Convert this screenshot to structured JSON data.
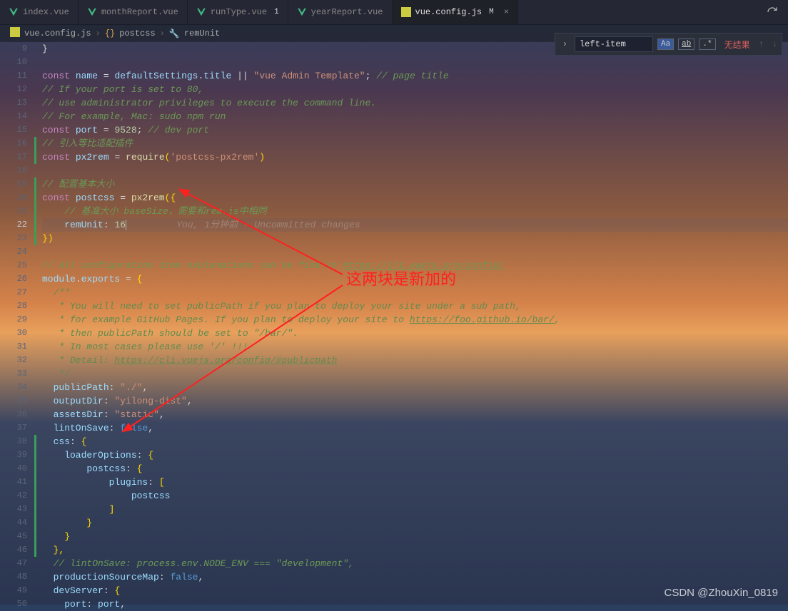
{
  "tabs": [
    {
      "label": "index.vue",
      "icon": "vue"
    },
    {
      "label": "monthReport.vue",
      "icon": "vue"
    },
    {
      "label": "runType.vue",
      "icon": "vue",
      "modified": "1"
    },
    {
      "label": "yearReport.vue",
      "icon": "vue"
    },
    {
      "label": "vue.config.js",
      "icon": "js",
      "modified": "M",
      "active": true,
      "close": "×"
    }
  ],
  "breadcrumbs": {
    "file_icon": "js",
    "file": "vue.config.js",
    "sym1_icon": "{}",
    "sym1": "postcss",
    "sym2_icon": "🔧",
    "sym2": "remUnit"
  },
  "find": {
    "expand": "›",
    "value": "left-item",
    "opt_case": "Aa",
    "opt_word": "ab",
    "opt_regex": ".*",
    "no_results": "无结果",
    "up": "↑",
    "down": "↓"
  },
  "line_start": 9,
  "line_end": 50,
  "current_line": 22,
  "code_lines": {
    "9": "}",
    "10": "",
    "11_kw": "const",
    "11_id": "name",
    "11_eq": " = ",
    "11_obj": "defaultSettings",
    "11_dot": ".",
    "11_prop": "title",
    "11_or": " || ",
    "11_str": "\"vue Admin Template\"",
    "11_sc": ";",
    "11_cmt": " // page title",
    "12": "// If your port is set to 80,",
    "13": "// use administrator privileges to execute the command line.",
    "14": "// For example, Mac: sudo npm run",
    "15_kw": "const",
    "15_id": "port",
    "15_eq": " = ",
    "15_num": "9528",
    "15_sc": ";",
    "15_cmt": " // dev port",
    "16": "// 引入等比适配插件",
    "17_kw": "const",
    "17_id": "px2rem",
    "17_eq": " = ",
    "17_fn": "require",
    "17_p1": "(",
    "17_str": "'postcss-px2rem'",
    "17_p2": ")",
    "18": "",
    "19": "// 配置基本大小",
    "20_kw": "const",
    "20_id": "postcss",
    "20_eq": " = ",
    "20_fn": "px2rem",
    "20_p1": "(",
    "20_b": "{",
    "21": "    // 基准大小 baseSize，需要和rem.js中相同",
    "22_prop": "    remUnit",
    "22_col": ": ",
    "22_num": "16",
    "22_blame": "         You, 1分钟前 · Uncommitted changes",
    "23_b": "}",
    "23_p": ")",
    "24": "",
    "25_a": "// All configuration item explanations can be find in ",
    "25_link": "https://cli.vuejs.org/config/",
    "26_obj": "module",
    "26_dot": ".",
    "26_prop": "exports",
    "26_eq": " = ",
    "26_b": "{",
    "27": "  /**",
    "28": "   * You will need to set publicPath if you plan to deploy your site under a sub path,",
    "29_a": "   * for example GitHub Pages. If you plan to deploy your site to ",
    "29_link": "https://foo.github.io/bar/",
    "29_b": ",",
    "30": "   * then publicPath should be set to \"/bar/\".",
    "31": "   * In most cases please use '/' !!!",
    "32_a": "   * Detail: ",
    "32_link": "https://cli.vuejs.org/config/#publicpath",
    "33": "   */",
    "34_p": "  publicPath",
    "34_c": ": ",
    "34_s": "\"./\"",
    "34_e": ",",
    "35_p": "  outputDir",
    "35_c": ": ",
    "35_s": "\"yilong-dist\"",
    "35_e": ",",
    "36_p": "  assetsDir",
    "36_c": ": ",
    "36_s": "\"static\"",
    "36_e": ",",
    "37_p": "  lintOnSave",
    "37_c": ": ",
    "37_v": "false",
    "37_e": ",",
    "38_p": "  css",
    "38_c": ": ",
    "38_b": "{",
    "39_p": "    loaderOptions",
    "39_c": ": ",
    "39_b": "{",
    "40_p": "        postcss",
    "40_c": ": ",
    "40_b": "{",
    "41_p": "            plugins",
    "41_c": ": ",
    "41_b": "[",
    "42": "                postcss",
    "43": "            ]",
    "44": "        }",
    "45": "    }",
    "46": "  },",
    "47": "  // lintOnSave: process.env.NODE_ENV === \"development\",",
    "48_p": "  productionSourceMap",
    "48_c": ": ",
    "48_v": "false",
    "48_e": ",",
    "49_p": "  devServer",
    "49_c": ": ",
    "49_b": "{",
    "50_p": "    port",
    "50_c": ": ",
    "50_v": "port",
    "50_e": ","
  },
  "annotation": {
    "text": "这两块是新加的"
  },
  "watermark": "CSDN @ZhouXin_0819"
}
